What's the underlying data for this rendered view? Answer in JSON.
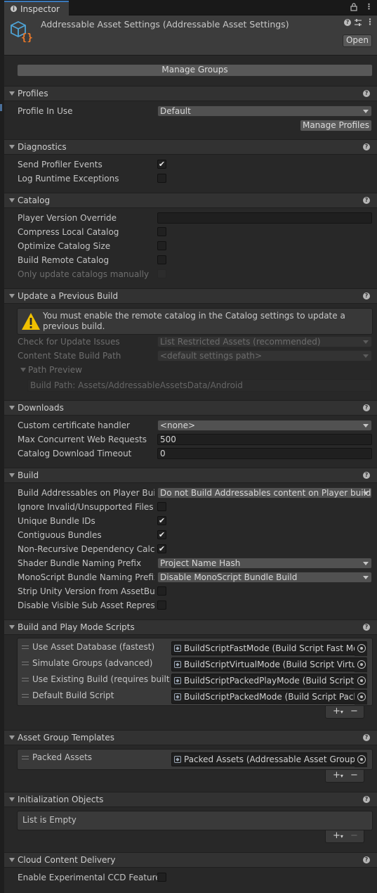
{
  "tab": {
    "label": "Inspector"
  },
  "header": {
    "title": "Addressable Asset Settings (Addressable Asset Settings)",
    "open_label": "Open"
  },
  "manage_groups_label": "Manage Groups",
  "profiles": {
    "title": "Profiles",
    "profile_in_use_label": "Profile In Use",
    "profile_value": "Default",
    "manage_profiles_label": "Manage Profiles"
  },
  "diagnostics": {
    "title": "Diagnostics",
    "send_profiler_label": "Send Profiler Events",
    "log_exceptions_label": "Log Runtime Exceptions"
  },
  "catalog": {
    "title": "Catalog",
    "player_version_label": "Player Version Override",
    "compress_label": "Compress Local Catalog",
    "optimize_label": "Optimize Catalog Size",
    "build_remote_label": "Build Remote Catalog",
    "only_update_label": "Only update catalogs manually"
  },
  "update_build": {
    "title": "Update a Previous Build",
    "warning": "You must enable the remote catalog in the Catalog settings to update a previous build.",
    "check_label": "Check for Update Issues",
    "check_value": "List Restricted Assets (recommended)",
    "content_state_label": "Content State Build Path",
    "content_state_value": "<default settings path>",
    "path_preview_label": "Path Preview",
    "build_path": "Build Path: Assets/AddressableAssetsData/Android"
  },
  "downloads": {
    "title": "Downloads",
    "cert_label": "Custom certificate handler",
    "cert_value": "<none>",
    "max_label": "Max Concurrent Web Requests",
    "max_value": "500",
    "timeout_label": "Catalog Download Timeout",
    "timeout_value": "0"
  },
  "build": {
    "title": "Build",
    "on_player_label": "Build Addressables on Player Build",
    "on_player_value": "Do not Build Addressables content on Player build",
    "ignore_label": "Ignore Invalid/Unsupported Files in",
    "unique_label": "Unique Bundle IDs",
    "contiguous_label": "Contiguous Bundles",
    "nonrecursive_label": "Non-Recursive Dependency Calcu",
    "shader_label": "Shader Bundle Naming Prefix",
    "shader_value": "Project Name Hash",
    "mono_label": "MonoScript Bundle Naming Prefix",
    "mono_value": "Disable MonoScript Bundle Build",
    "strip_label": "Strip Unity Version from AssetBundl",
    "disable_visible_label": "Disable Visible Sub Asset Represen"
  },
  "play_mode": {
    "title": "Build and Play Mode Scripts",
    "items": [
      {
        "label": "Use Asset Database (fastest)",
        "value": "BuildScriptFastMode (Build Script Fast Mod"
      },
      {
        "label": "Simulate Groups (advanced)",
        "value": "BuildScriptVirtualMode (Build Script Virtual"
      },
      {
        "label": "Use Existing Build (requires built gro",
        "value": "BuildScriptPackedPlayMode (Build Script P"
      },
      {
        "label": "Default Build Script",
        "value": "BuildScriptPackedMode (Build Script Packe"
      }
    ]
  },
  "templates": {
    "title": "Asset Group Templates",
    "item_label": "Packed Assets",
    "item_value": "Packed Assets (Addressable Asset Group Te"
  },
  "init_objects": {
    "title": "Initialization Objects",
    "empty_label": "List is Empty"
  },
  "ccd": {
    "title": "Cloud Content Delivery",
    "enable_label": "Enable Experimental CCD Features"
  },
  "icons": {
    "lock": "lock-icon",
    "menu": "kebab-menu-icon",
    "help": "help-icon",
    "settings": "preset-sliders-icon",
    "asset": "addressables-settings-icon",
    "warning": "warning-icon"
  },
  "colors": {
    "accent": "#3a79bb",
    "warning": "#f0c000",
    "asset_icon_blue": "#4ea4d6",
    "asset_icon_orange": "#f07a28"
  }
}
